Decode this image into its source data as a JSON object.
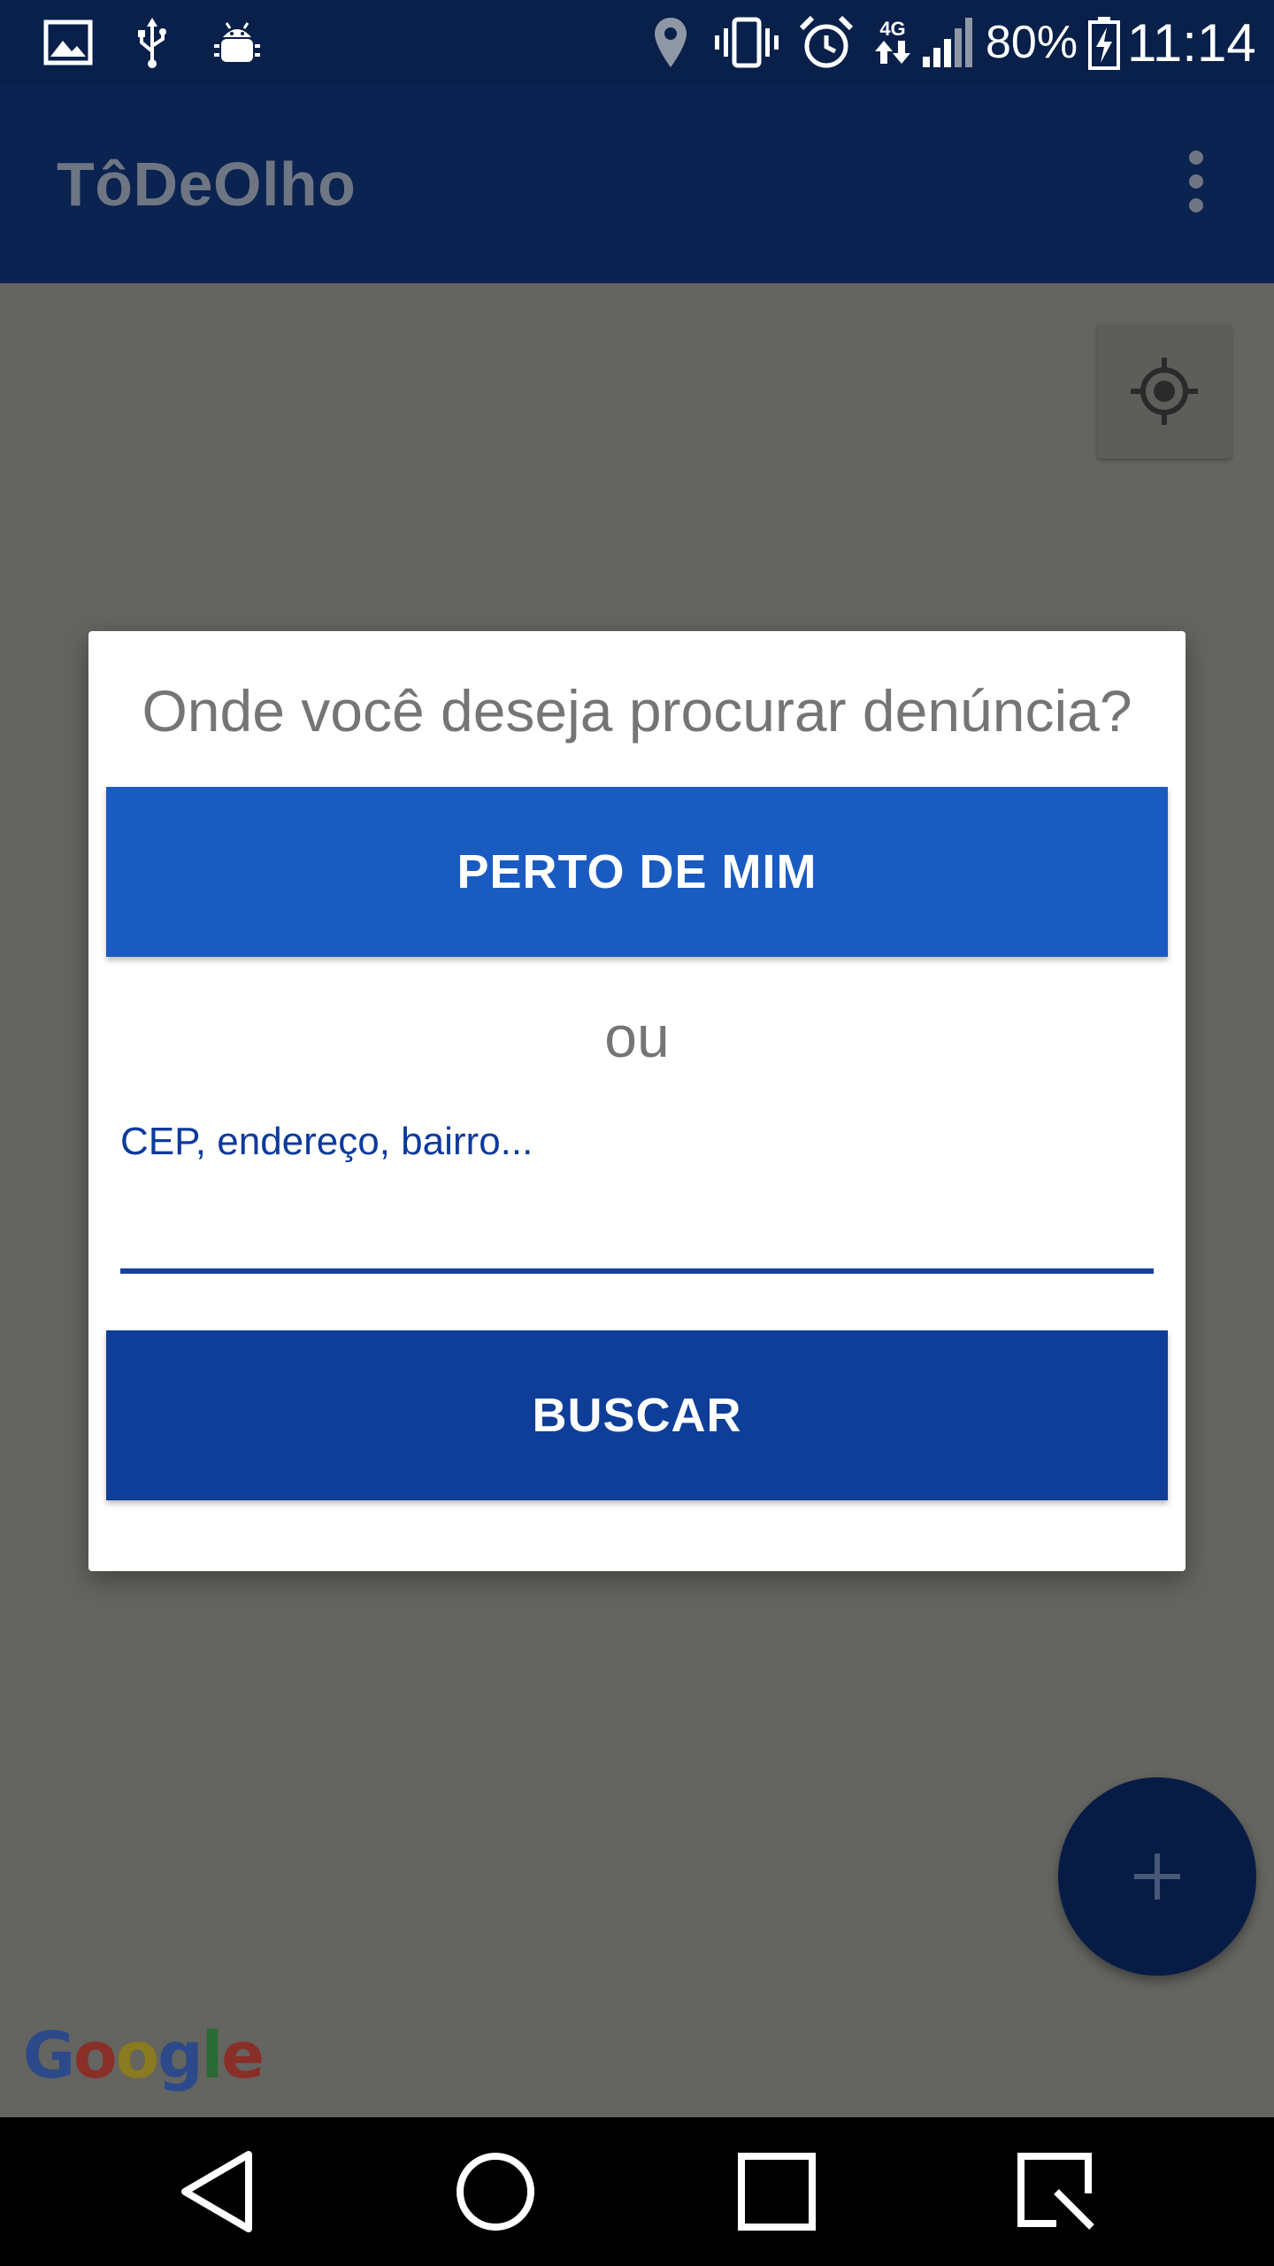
{
  "status_bar": {
    "battery": "80%",
    "time": "11:14",
    "network": "4G",
    "icons": [
      "image-icon",
      "usb-icon",
      "android-debug-icon",
      "location-pin-icon",
      "vibrate-icon",
      "alarm-icon",
      "network-4g-icon",
      "signal-icon",
      "battery-charging-icon"
    ]
  },
  "app_bar": {
    "title": "TôDeOlho",
    "menu_icon": "overflow-menu-icon"
  },
  "map": {
    "logo": {
      "g1": "G",
      "o1": "o",
      "o2": "o",
      "g2": "g",
      "l": "l",
      "e": "e"
    },
    "my_location_icon": "my-location-icon",
    "fab_icon": "plus-icon"
  },
  "dialog": {
    "title": "Onde você deseja procurar denúncia?",
    "near_button_label": "PERTO DE MIM",
    "or_text": "ou",
    "search_label": "CEP, endereço, bairro...",
    "search_value": "",
    "search_button_label": "BUSCAR"
  },
  "nav_bar": {
    "icons": [
      "back-icon",
      "home-icon",
      "recents-icon",
      "screenshot-icon"
    ]
  },
  "colors": {
    "status_bar": "#08204a",
    "app_bar": "#0b2350",
    "primary_button": "#1a5bc2",
    "secondary_button": "#0e3e98",
    "map_scrim": "#646460",
    "fab": "#071c45"
  }
}
